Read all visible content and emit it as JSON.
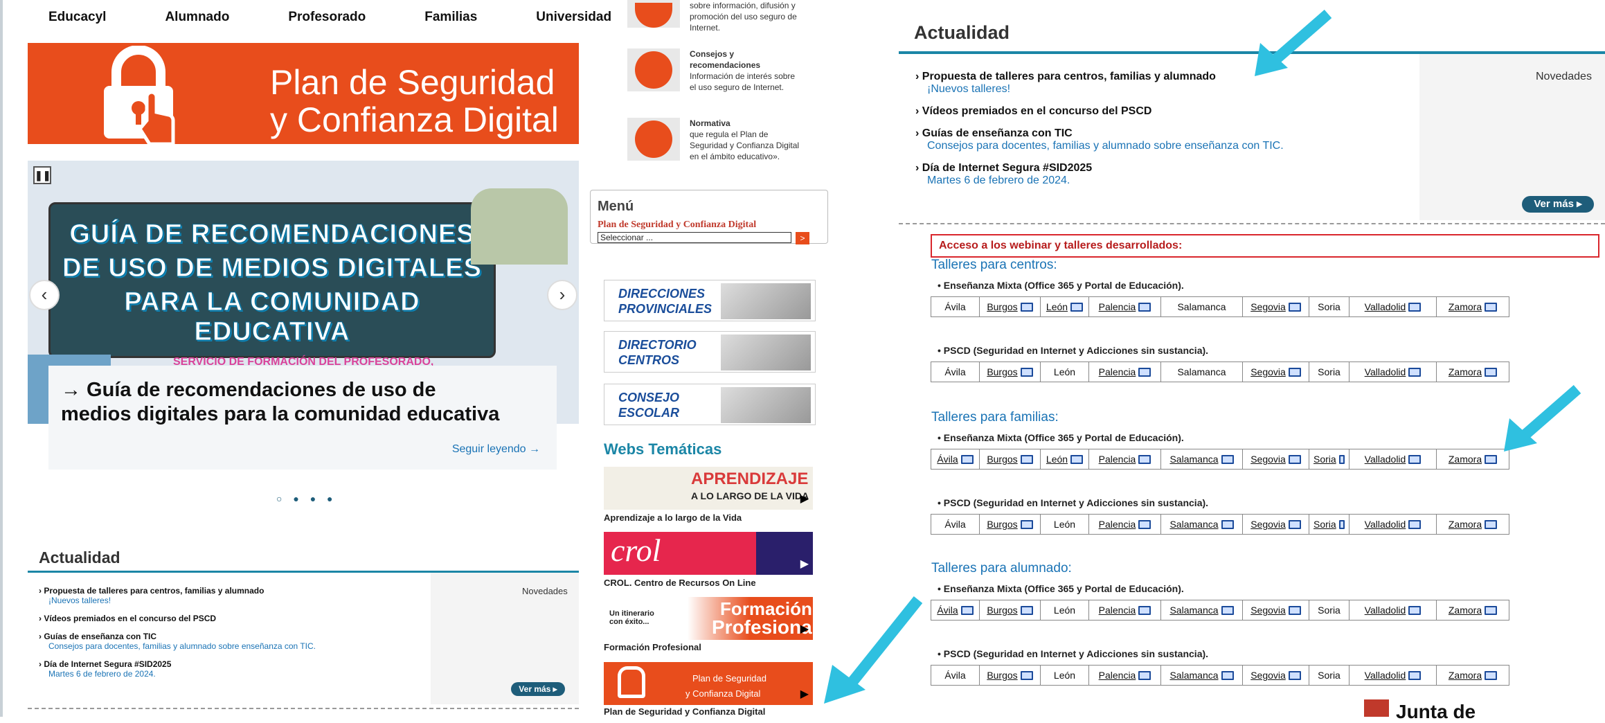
{
  "topnav": [
    "Educacyl",
    "Alumnado",
    "Profesorado",
    "Familias",
    "Universidad"
  ],
  "banner": {
    "line1": "Plan de Seguridad",
    "line2": "y Confianza Digital"
  },
  "slide": {
    "board": [
      "GUÍA DE RECOMENDACIONES",
      "DE USO DE MEDIOS DIGITALES",
      "PARA LA COMUNIDAD EDUCATIVA"
    ],
    "subtitle": "SERVICIO DE FORMACIÓN DEL PROFESORADO,",
    "caption_title": "→ Guía de recomendaciones de uso de medios digitales para la comunidad educativa",
    "read_more": "Seguir leyendo →",
    "dots": "○ ● ● ●"
  },
  "actualidad": {
    "title": "Actualidad",
    "novedades": "Novedades",
    "ver_mas": "Ver más ▸",
    "items": [
      {
        "h": "Propuesta de talleres para centros, familias y alumnado",
        "s": "¡Nuevos talleres!"
      },
      {
        "h": "Vídeos premiados en el concurso del PSCD",
        "s": ""
      },
      {
        "h": "Guías de enseñanza con TIC",
        "s": "Consejos para docentes, familias y alumnado sobre enseñanza con TIC."
      },
      {
        "h": "Día de Internet Segura #SID2025",
        "s": "Martes 6 de febrero de 2024."
      }
    ]
  },
  "mid": {
    "card0": "sobre información, difusión y promoción del uso seguro de Internet.",
    "card1_title": "Consejos y recomendaciones",
    "card1_text": "Información de interés sobre el uso seguro de Internet.",
    "card2_title": "Normativa",
    "card2_text": "que regula el Plan de Seguridad y Confianza Digital en el ámbito educativo».",
    "menu_title": "Menú",
    "menu_sub": "Plan de Seguridad y Confianza Digital",
    "menu_select": "Seleccionar ...",
    "menu_go": ">",
    "dirs": [
      "DIRECCIONES PROVINCIALES",
      "DIRECTORIO CENTROS",
      "CONSEJO ESCOLAR"
    ],
    "webs_title": "Webs Temáticas",
    "webs": [
      "Aprendizaje a lo largo de la Vida",
      "CROL. Centro de Recursos On Line",
      "Formación Profesional",
      "Plan de Seguridad y Confianza Digital"
    ],
    "web_texts": {
      "apr1": "APRENDIZAJE",
      "apr2": "A LO LARGO DE LA VIDA",
      "crol": "crol",
      "fp1": "Formación",
      "fp2": "Profesional",
      "fp_small": "Un itinerario con éxito...",
      "psc1": "Plan de Seguridad",
      "psc2": "y Confianza Digital"
    }
  },
  "webinar": {
    "title": "Acceso a los webinar y talleres desarrollados:",
    "groups": [
      {
        "head": "Talleres para centros:",
        "rows": [
          {
            "label": "Enseñanza Mixta (Office 365 y Portal de Educación).",
            "cells": [
              [
                "Ávila",
                0
              ],
              [
                "Burgos",
                1
              ],
              [
                "León",
                1
              ],
              [
                "Palencia",
                1
              ],
              [
                "Salamanca",
                0
              ],
              [
                "Segovia",
                1
              ],
              [
                "Soria",
                0
              ],
              [
                "Valladolid",
                1
              ],
              [
                "Zamora",
                1
              ]
            ]
          },
          {
            "label": "PSCD (Seguridad en Internet y Adicciones sin sustancia).",
            "cells": [
              [
                "Ávila",
                0
              ],
              [
                "Burgos",
                1
              ],
              [
                "León",
                0
              ],
              [
                "Palencia",
                1
              ],
              [
                "Salamanca",
                0
              ],
              [
                "Segovia",
                1
              ],
              [
                "Soria",
                0
              ],
              [
                "Valladolid",
                1
              ],
              [
                "Zamora",
                1
              ]
            ]
          }
        ]
      },
      {
        "head": "Talleres para familias:",
        "rows": [
          {
            "label": "Enseñanza Mixta (Office 365 y Portal de Educación).",
            "cells": [
              [
                "Ávila",
                1
              ],
              [
                "Burgos",
                1
              ],
              [
                "León",
                1
              ],
              [
                "Palencia",
                1
              ],
              [
                "Salamanca",
                1
              ],
              [
                "Segovia",
                1
              ],
              [
                "Soria",
                1
              ],
              [
                "Valladolid",
                1
              ],
              [
                "Zamora",
                1
              ]
            ]
          },
          {
            "label": "PSCD (Seguridad en Internet y Adicciones sin sustancia).",
            "cells": [
              [
                "Ávila",
                0
              ],
              [
                "Burgos",
                1
              ],
              [
                "León",
                0
              ],
              [
                "Palencia",
                1
              ],
              [
                "Salamanca",
                1
              ],
              [
                "Segovia",
                1
              ],
              [
                "Soria",
                1
              ],
              [
                "Valladolid",
                1
              ],
              [
                "Zamora",
                1
              ]
            ]
          }
        ]
      },
      {
        "head": "Talleres para alumnado:",
        "rows": [
          {
            "label": "Enseñanza Mixta (Office 365 y Portal de Educación).",
            "cells": [
              [
                "Ávila",
                1
              ],
              [
                "Burgos",
                1
              ],
              [
                "León",
                0
              ],
              [
                "Palencia",
                1
              ],
              [
                "Salamanca",
                1
              ],
              [
                "Segovia",
                1
              ],
              [
                "Soria",
                0
              ],
              [
                "Valladolid",
                1
              ],
              [
                "Zamora",
                1
              ]
            ]
          },
          {
            "label": "PSCD (Seguridad en Internet y Adicciones sin sustancia).",
            "cells": [
              [
                "Ávila",
                0
              ],
              [
                "Burgos",
                1
              ],
              [
                "León",
                0
              ],
              [
                "Palencia",
                1
              ],
              [
                "Salamanca",
                1
              ],
              [
                "Segovia",
                1
              ],
              [
                "Soria",
                0
              ],
              [
                "Valladolid",
                1
              ],
              [
                "Zamora",
                1
              ]
            ]
          }
        ]
      }
    ]
  },
  "footer_logo": "Junta de",
  "colors": {
    "orange": "#e84d1c",
    "teal": "#1b86a6",
    "link": "#1a73b5",
    "arrow": "#2fc0e0"
  }
}
